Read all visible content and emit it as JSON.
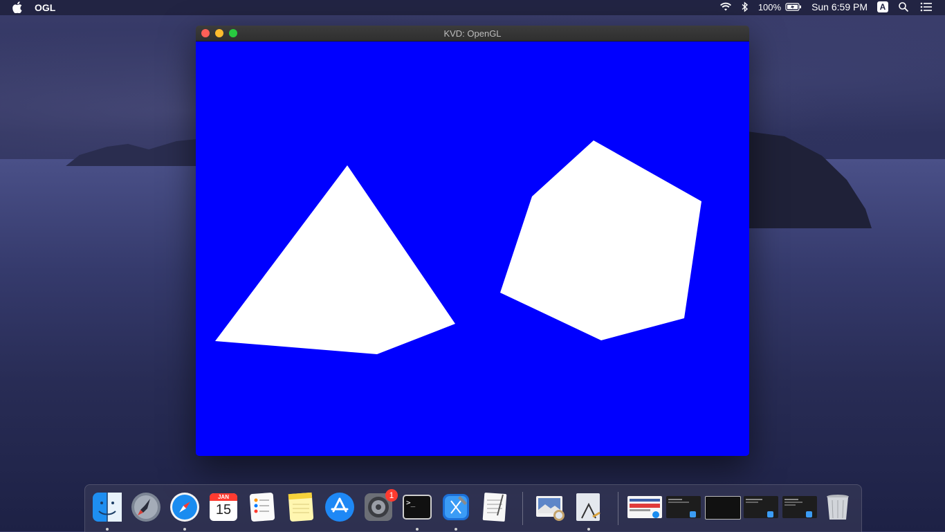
{
  "menubar": {
    "app_name": "OGL",
    "battery": "100%",
    "clock": "Sun 6:59 PM",
    "input_source": "A"
  },
  "window": {
    "title": "KVD: OpenGL",
    "canvas_color": "#0000ff",
    "shape_color": "#ffffff"
  },
  "dock": {
    "calendar_month": "JAN",
    "calendar_day": "15",
    "system_prefs_badge": "1",
    "terminal_prompt": ">_"
  },
  "colors": {
    "close": "#ff5f57",
    "minimize": "#febc2e",
    "maximize": "#28c840"
  }
}
